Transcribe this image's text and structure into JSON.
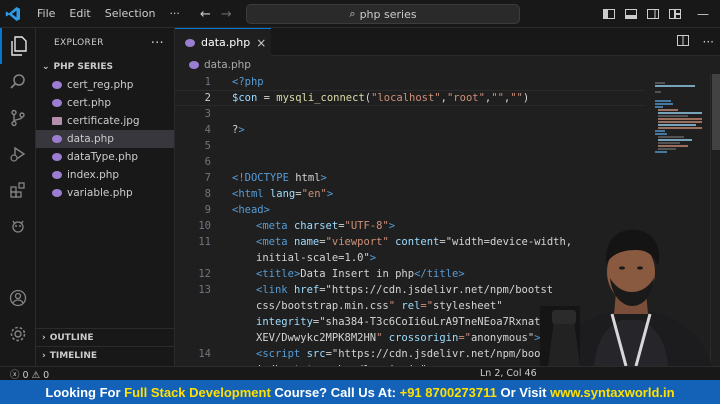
{
  "menu": [
    "File",
    "Edit",
    "Selection"
  ],
  "search": {
    "text": "php series"
  },
  "explorer": {
    "title": "EXPLORER",
    "folder": "PHP SERIES",
    "files": [
      {
        "name": "cert_reg.php",
        "type": "php"
      },
      {
        "name": "cert.php",
        "type": "php"
      },
      {
        "name": "certificate.jpg",
        "type": "image"
      },
      {
        "name": "data.php",
        "type": "php",
        "selected": true
      },
      {
        "name": "dataType.php",
        "type": "php"
      },
      {
        "name": "index.php",
        "type": "php"
      },
      {
        "name": "variable.php",
        "type": "php"
      }
    ],
    "outline": "OUTLINE",
    "timeline": "TIMELINE"
  },
  "editor": {
    "tab": "data.php",
    "breadcrumb": "data.php",
    "lines": [
      {
        "n": "1",
        "t": "<?php"
      },
      {
        "n": "2",
        "t": "$con = mysqli_connect(\"localhost\",\"root\",\"\",\"\")"
      },
      {
        "n": "3",
        "t": ""
      },
      {
        "n": "4",
        "t": "?>"
      },
      {
        "n": "5",
        "t": ""
      },
      {
        "n": "6",
        "t": ""
      },
      {
        "n": "7",
        "t": "<!DOCTYPE html>"
      },
      {
        "n": "8",
        "t": "<html lang=\"en\">"
      },
      {
        "n": "9",
        "t": "<head>"
      },
      {
        "n": "10",
        "t": "<meta charset=\"UTF-8\">"
      },
      {
        "n": "11",
        "t": "<meta name=\"viewport\" content=\"width=device-width,"
      },
      {
        "n": "",
        "t": "initial-scale=1.0\">"
      },
      {
        "n": "12",
        "t": "<title>Data Insert in php</title>"
      },
      {
        "n": "13",
        "t": "<link href=\"https://cdn.jsdelivr.net/npm/bootst"
      },
      {
        "n": "",
        "t": "css/bootstrap.min.css\" rel=\"stylesheet\""
      },
      {
        "n": "",
        "t": "integrity=\"sha384-T3c6CoIi6uLrA9TneNEoa7Rxnatz"
      },
      {
        "n": "",
        "t": "XEV/Dwwykc2MPK8M2HN\" crossorigin=\"anonymous\">"
      },
      {
        "n": "14",
        "t": "<script src=\"https://cdn.jsdelivr.net/npm/boo"
      },
      {
        "n": "",
        "t": "js/bootstrap.bundle.min.js\""
      }
    ]
  },
  "status": {
    "errors": "0",
    "warnings": "0",
    "position": "Ln 2, Col 46"
  },
  "banner": {
    "part1": "Looking For ",
    "highlight1": "Full Stack Development",
    "part2": " Course? Call Us At: ",
    "highlight2": "+91 8700273711",
    "part3": " Or Visit ",
    "highlight3": "www.syntaxworld.in"
  },
  "colors": {
    "accent": "#0078d4",
    "banner_bg": "#1462b8",
    "banner_highlight": "#ffe000"
  }
}
